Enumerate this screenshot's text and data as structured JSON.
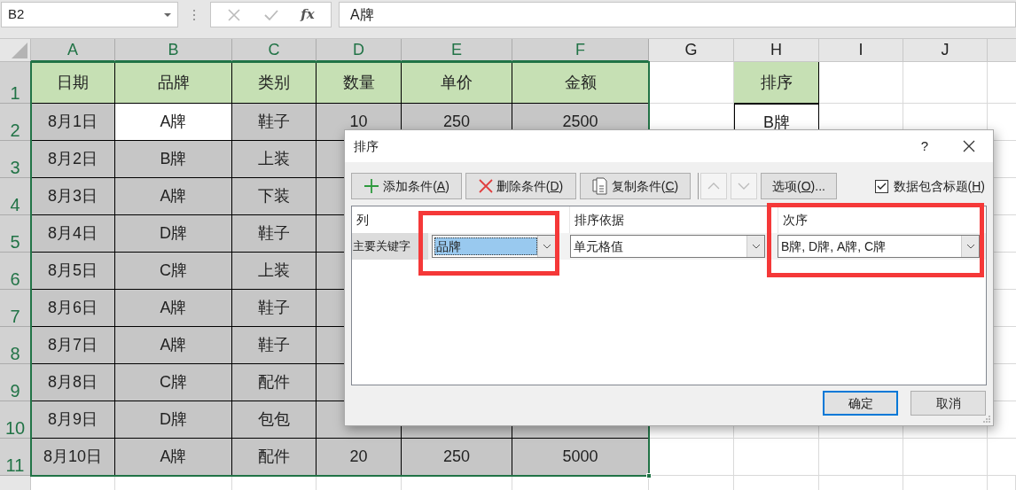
{
  "formula_bar": {
    "name_box": "B2",
    "fx": "fx",
    "formula": "A牌"
  },
  "sheet": {
    "columns": [
      {
        "label": "A",
        "selected": true
      },
      {
        "label": "B",
        "selected": true
      },
      {
        "label": "C",
        "selected": true
      },
      {
        "label": "D",
        "selected": true
      },
      {
        "label": "E",
        "selected": true
      },
      {
        "label": "F",
        "selected": true
      },
      {
        "label": "G",
        "selected": false
      },
      {
        "label": "H",
        "selected": false
      },
      {
        "label": "I",
        "selected": false
      },
      {
        "label": "J",
        "selected": false
      }
    ],
    "rows": [
      {
        "number": "1",
        "selected": true,
        "cells": [
          {
            "text": "日期",
            "active": false
          },
          {
            "text": "品牌",
            "active": false
          },
          {
            "text": "类别",
            "active": false
          },
          {
            "text": "数量",
            "active": false
          },
          {
            "text": "单价",
            "active": false
          },
          {
            "text": "金额",
            "active": false
          }
        ]
      },
      {
        "number": "2",
        "selected": true,
        "cells": [
          {
            "text": "8月1日",
            "active": false
          },
          {
            "text": "A牌",
            "active": true
          },
          {
            "text": "鞋子",
            "active": false
          },
          {
            "text": "10",
            "active": false
          },
          {
            "text": "250",
            "active": false
          },
          {
            "text": "2500",
            "active": false
          }
        ]
      },
      {
        "number": "3",
        "selected": true,
        "cells": [
          {
            "text": "8月2日",
            "active": false
          },
          {
            "text": "B牌",
            "active": false
          },
          {
            "text": "上装",
            "active": false
          }
        ]
      },
      {
        "number": "4",
        "selected": true,
        "cells": [
          {
            "text": "8月3日",
            "active": false
          },
          {
            "text": "A牌",
            "active": false
          },
          {
            "text": "下装",
            "active": false
          }
        ]
      },
      {
        "number": "5",
        "selected": true,
        "cells": [
          {
            "text": "8月4日",
            "active": false
          },
          {
            "text": "D牌",
            "active": false
          },
          {
            "text": "鞋子",
            "active": false
          }
        ]
      },
      {
        "number": "6",
        "selected": true,
        "cells": [
          {
            "text": "8月5日",
            "active": false
          },
          {
            "text": "C牌",
            "active": false
          },
          {
            "text": "上装",
            "active": false
          }
        ]
      },
      {
        "number": "7",
        "selected": true,
        "cells": [
          {
            "text": "8月6日",
            "active": false
          },
          {
            "text": "A牌",
            "active": false
          },
          {
            "text": "鞋子",
            "active": false
          }
        ]
      },
      {
        "number": "8",
        "selected": true,
        "cells": [
          {
            "text": "8月7日",
            "active": false
          },
          {
            "text": "A牌",
            "active": false
          },
          {
            "text": "鞋子",
            "active": false
          }
        ]
      },
      {
        "number": "9",
        "selected": true,
        "cells": [
          {
            "text": "8月8日",
            "active": false
          },
          {
            "text": "C牌",
            "active": false
          },
          {
            "text": "配件",
            "active": false
          }
        ]
      },
      {
        "number": "10",
        "selected": true,
        "cells": [
          {
            "text": "8月9日",
            "active": false
          },
          {
            "text": "D牌",
            "active": false
          },
          {
            "text": "包包",
            "active": false
          }
        ]
      },
      {
        "number": "11",
        "selected": true,
        "cells": [
          {
            "text": "8月10日",
            "active": false
          },
          {
            "text": "A牌",
            "active": false
          },
          {
            "text": "配件",
            "active": false
          },
          {
            "text": "20",
            "active": false
          },
          {
            "text": "250",
            "active": false
          },
          {
            "text": "5000",
            "active": false
          }
        ]
      }
    ],
    "sort_list": {
      "header": "排序",
      "items": [
        "B牌"
      ]
    }
  },
  "dialog": {
    "title": "排序",
    "help": "?",
    "toolbar": [
      {
        "kind": "add",
        "before": "添加条件(",
        "accel": "A",
        "after": ")",
        "disabled": false
      },
      {
        "kind": "delete",
        "before": "删除条件(",
        "accel": "D",
        "after": ")",
        "disabled": false
      },
      {
        "kind": "copy",
        "before": "复制条件(",
        "accel": "C",
        "after": ")",
        "disabled": false
      },
      {
        "kind": "up",
        "disabled": true
      },
      {
        "kind": "down",
        "disabled": true
      },
      {
        "kind": "text",
        "before": "选项(",
        "accel": "O",
        "after": ")...",
        "disabled": false
      }
    ],
    "has_headers": {
      "before": "数据包含标题(",
      "accel": "H",
      "after": ")",
      "checked": true
    },
    "columns": [
      "列",
      "排序依据",
      "次序"
    ],
    "levels": [
      {
        "label": "主要关键字",
        "column": "品牌",
        "sort_on": "单元格值",
        "order": "B牌, D牌, A牌, C牌",
        "selected": true
      }
    ],
    "buttons": [
      {
        "label": "确定",
        "default": true
      },
      {
        "label": "取消",
        "default": false
      }
    ]
  }
}
